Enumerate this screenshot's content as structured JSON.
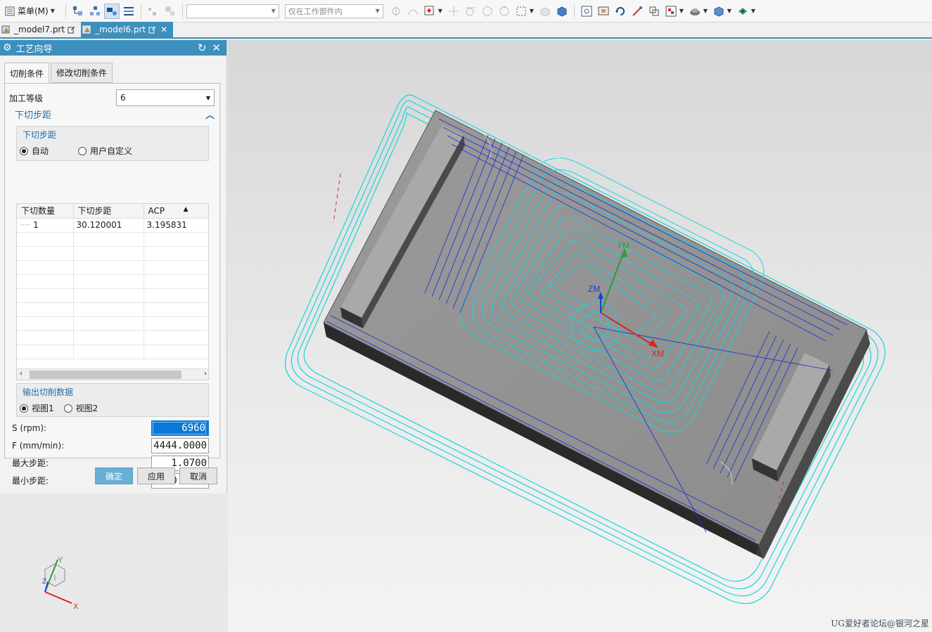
{
  "toolbar": {
    "menu_label": "菜单(M)",
    "filter_select": "",
    "scope_select": "仅在工作部件内"
  },
  "file_tabs": [
    {
      "label": "_model7.prt",
      "active": false
    },
    {
      "label": "_model6.prt",
      "active": true
    }
  ],
  "dialog": {
    "title": "工艺向导",
    "tabs": [
      "切削条件",
      "修改切削条件"
    ],
    "level_label": "加工等级",
    "level_value": "6",
    "section_title": "下切步距",
    "stepdown_group": {
      "title": "下切步距",
      "options": [
        "自动",
        "用户自定义"
      ],
      "selected": "自动"
    },
    "table": {
      "headers": [
        "下切数量",
        "下切步距",
        "ACP"
      ],
      "rows": [
        [
          "1",
          "30.120001",
          "3.195831"
        ]
      ]
    },
    "output_group": {
      "title": "输出切削数据",
      "options": [
        "视图1",
        "视图2"
      ],
      "selected": "视图1"
    },
    "fields": [
      {
        "label": "S (rpm):",
        "value": "6960"
      },
      {
        "label": "F (mm/min):",
        "value": "4444.0000"
      },
      {
        "label": "最大步距:",
        "value": "1.0700"
      },
      {
        "label": "最小步距:",
        "value": "0.3600"
      }
    ],
    "buttons": {
      "ok": "确定",
      "apply": "应用",
      "cancel": "取消"
    }
  },
  "viewport": {
    "wcs_labels": {
      "x": "XM",
      "y": "YM",
      "z": "ZM"
    },
    "triad_labels": {
      "x": "X",
      "y": "Y",
      "z": "Z"
    },
    "watermark": "UG爱好者论坛@银河之星"
  },
  "colors": {
    "accent": "#3d8fbd",
    "toolpath_cyan": "#19d4e0",
    "toolpath_blue": "#1b2ad6"
  }
}
